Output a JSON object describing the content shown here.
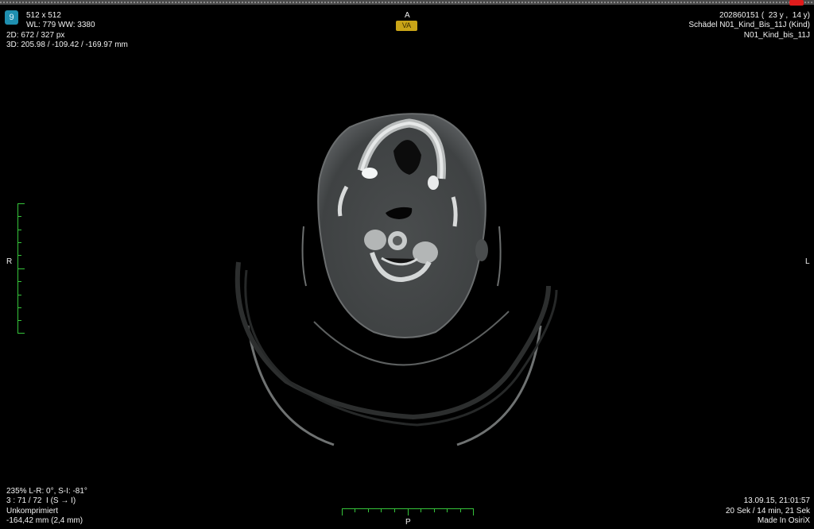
{
  "top_left": {
    "frame_number": "9",
    "matrix": "512 x 512",
    "window": "WL: 779 WW: 3380",
    "pos2d": "2D: 672 / 327 px",
    "pos3d": "3D: 205.98 / -109.42 / -169.97 mm"
  },
  "top_right": {
    "patient": "202860151 (  23 y ,  14 y)",
    "study": "Schädel N01_Kind_Bis_11J (Kind)",
    "series": "N01_Kind_bis_11J"
  },
  "orientation": {
    "top": "A",
    "bottom": "P",
    "left": "R",
    "right": "L",
    "view_badge": "VA"
  },
  "bottom_left": {
    "zoom_angle": "235% L-R: 0°, S-I: -81°",
    "slice": "3 : 71 / 72  I (S → I)",
    "compression": "Unkomprimiert",
    "location": "-164,42 mm (2,4 mm)"
  },
  "bottom_right": {
    "datetime": "13.09.15, 21:01:57",
    "acq_time": "20 Sek / 14 min, 21 Sek",
    "credit": "Made In OsiriX"
  },
  "colors": {
    "ruler": "#35c43a",
    "slice_marker": "#e01c1c",
    "badge": "#1f8fb0",
    "view_badge": "#c9a417"
  }
}
